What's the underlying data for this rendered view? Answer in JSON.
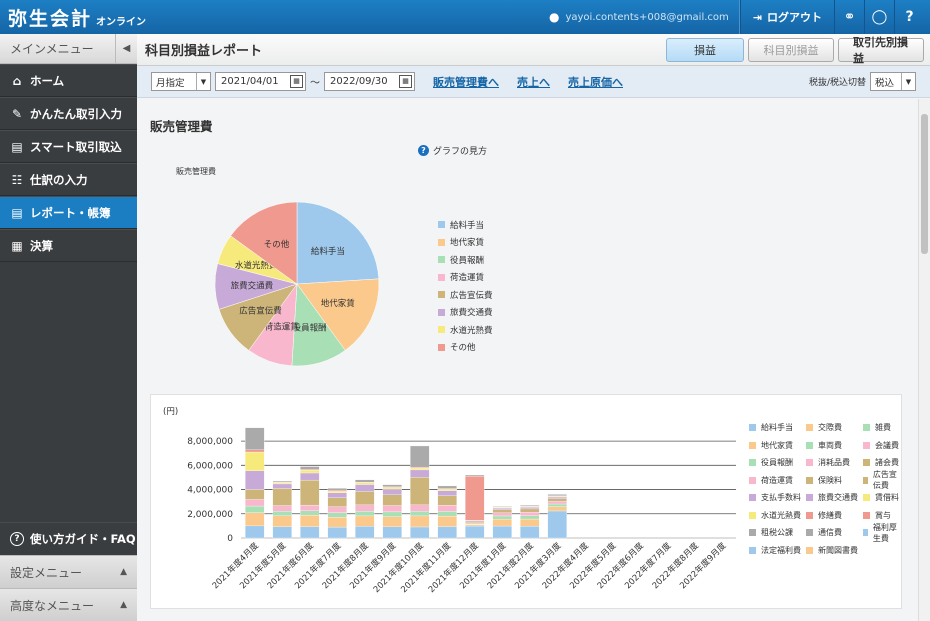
{
  "app": {
    "logo": "弥生会計",
    "logo_sub": "オンライン",
    "user_email": "yayoi.contents+008@gmail.com",
    "logout": "ログアウト"
  },
  "sidebar": {
    "header": "メインメニュー",
    "items": [
      {
        "label": "ホーム",
        "icon": "home-icon"
      },
      {
        "label": "かんたん取引入力",
        "icon": "pencil-icon"
      },
      {
        "label": "スマート取引取込",
        "icon": "import-icon"
      },
      {
        "label": "仕訳の入力",
        "icon": "journal-icon"
      },
      {
        "label": "レポート・帳簿",
        "icon": "chart-icon"
      },
      {
        "label": "決算",
        "icon": "calculator-icon"
      }
    ],
    "guide": "使い方ガイド・FAQ",
    "settings_menu": "設定メニュー",
    "advanced_menu": "高度なメニュー"
  },
  "header": {
    "title": "科目別損益レポート",
    "tabs": [
      "損益",
      "科目別損益",
      "取引先別損益"
    ]
  },
  "filter": {
    "period_mode": "月指定",
    "date_from": "2021/04/01",
    "tilde": "～",
    "date_to": "2022/09/30",
    "links": [
      "販売管理費へ",
      "売上へ",
      "売上原価へ"
    ],
    "tax_label": "税抜/税込切替",
    "tax_value": "税込"
  },
  "section": {
    "title": "販売管理費",
    "help": "グラフの見方",
    "pie_caption": "販売管理費",
    "bar_unit": "(円)"
  },
  "colors": {
    "topbar": "#1b74b8",
    "active": "#1b7ec2",
    "sidebar": "#3a3d40"
  },
  "chart_data": [
    {
      "type": "pie",
      "title": "販売管理費",
      "categories": [
        "給料手当",
        "地代家賃",
        "役員報酬",
        "荷造運賃",
        "広告宣伝費",
        "旅費交通費",
        "水道光熱費",
        "その他"
      ],
      "values": [
        24,
        16,
        11,
        9,
        10,
        9,
        6,
        15
      ],
      "colors": [
        "#9ec9ec",
        "#fbc98b",
        "#a9dfb5",
        "#f8b7cd",
        "#cdb57a",
        "#c8aad8",
        "#f7ea7c",
        "#f0998f"
      ],
      "slice_labels": [
        "給料手当",
        "地代家賃",
        "役員報酬",
        "荷造運賃",
        "広告宣伝費",
        "旅費交通費",
        "水道光熱費",
        "その他"
      ],
      "legend_position": "right"
    },
    {
      "type": "bar",
      "ylabel": "(円)",
      "ylim": [
        0,
        9000000
      ],
      "yticks": [
        "0",
        "2,000,000",
        "4,000,000",
        "6,000,000",
        "8,000,000"
      ],
      "categories": [
        "2021年度4月度",
        "2021年度5月度",
        "2021年度6月度",
        "2021年度7月度",
        "2021年度8月度",
        "2021年度9月度",
        "2021年度10月度",
        "2021年度11月度",
        "2021年度12月度",
        "2021年度1月度",
        "2021年度2月度",
        "2021年度3月度",
        "2022年度4月度",
        "2022年度5月度",
        "2022年度6月度",
        "2022年度7月度",
        "2022年度8月度",
        "2022年度9月度"
      ],
      "totals": [
        9100000,
        4700000,
        5900000,
        4100000,
        4800000,
        4400000,
        7600000,
        4300000,
        5200000,
        2600000,
        2700000,
        3600000,
        0,
        0,
        0,
        0,
        0,
        0
      ],
      "series_legend": [
        {
          "name": "給料手当",
          "color": "#9ec9ec"
        },
        {
          "name": "交際費",
          "color": "#fbc98b"
        },
        {
          "name": "雑費",
          "color": "#a9dfb5"
        },
        {
          "name": "地代家賃",
          "color": "#fbc98b"
        },
        {
          "name": "車両費",
          "color": "#a9dfb5"
        },
        {
          "name": "会議費",
          "color": "#f8b7cd"
        },
        {
          "name": "役員報酬",
          "color": "#a9dfb5"
        },
        {
          "name": "消耗品費",
          "color": "#f8b7cd"
        },
        {
          "name": "諸会費",
          "color": "#cdb57a"
        },
        {
          "name": "荷造運賃",
          "color": "#f8b7cd"
        },
        {
          "name": "保険料",
          "color": "#cdb57a"
        },
        {
          "name": "広告宣伝費",
          "color": "#cdb57a"
        },
        {
          "name": "支払手数料",
          "color": "#c8aad8"
        },
        {
          "name": "旅費交通費",
          "color": "#c8aad8"
        },
        {
          "name": "賃借料",
          "color": "#f7ea7c"
        },
        {
          "name": "水道光熱費",
          "color": "#f7ea7c"
        },
        {
          "name": "修繕費",
          "color": "#f0998f"
        },
        {
          "name": "賞与",
          "color": "#f0998f"
        },
        {
          "name": "租税公課",
          "color": "#aaaaaa"
        },
        {
          "name": "通信費",
          "color": "#aaaaaa"
        },
        {
          "name": "福利厚生費",
          "color": "#9ec9ec"
        },
        {
          "name": "法定福利費",
          "color": "#9ec9ec"
        },
        {
          "name": "新聞図書費",
          "color": "#fbc98b"
        }
      ],
      "stack_colors": [
        "#9ec9ec",
        "#fbc98b",
        "#a9dfb5",
        "#f8b7cd",
        "#cdb57a",
        "#c8aad8",
        "#f7ea7c",
        "#f0998f",
        "#aaaaaa"
      ],
      "stack_shares": [
        [
          0.11,
          0.12,
          0.06,
          0.06,
          0.09,
          0.17,
          0.17,
          0.02,
          0.2
        ],
        [
          0.2,
          0.19,
          0.08,
          0.1,
          0.3,
          0.08,
          0.02,
          0.01,
          0.02
        ],
        [
          0.16,
          0.16,
          0.06,
          0.08,
          0.35,
          0.1,
          0.04,
          0.01,
          0.04
        ],
        [
          0.22,
          0.2,
          0.09,
          0.12,
          0.18,
          0.1,
          0.03,
          0.02,
          0.04
        ],
        [
          0.2,
          0.18,
          0.08,
          0.11,
          0.23,
          0.12,
          0.03,
          0.01,
          0.04
        ],
        [
          0.21,
          0.19,
          0.09,
          0.12,
          0.2,
          0.11,
          0.03,
          0.01,
          0.04
        ],
        [
          0.12,
          0.12,
          0.05,
          0.07,
          0.3,
          0.08,
          0.02,
          0.01,
          0.23
        ],
        [
          0.22,
          0.2,
          0.09,
          0.12,
          0.18,
          0.1,
          0.03,
          0.01,
          0.05
        ],
        [
          0.19,
          0.02,
          0.01,
          0.01,
          0.02,
          0.02,
          0.01,
          0.7,
          0.02
        ],
        [
          0.38,
          0.22,
          0.1,
          0.1,
          0.1,
          0.05,
          0.02,
          0.01,
          0.02
        ],
        [
          0.36,
          0.22,
          0.1,
          0.11,
          0.1,
          0.05,
          0.02,
          0.01,
          0.03
        ],
        [
          0.62,
          0.1,
          0.06,
          0.06,
          0.06,
          0.04,
          0.02,
          0.01,
          0.03
        ],
        [
          0,
          0,
          0,
          0,
          0,
          0,
          0,
          0,
          0
        ],
        [
          0,
          0,
          0,
          0,
          0,
          0,
          0,
          0,
          0
        ],
        [
          0,
          0,
          0,
          0,
          0,
          0,
          0,
          0,
          0
        ],
        [
          0,
          0,
          0,
          0,
          0,
          0,
          0,
          0,
          0
        ],
        [
          0,
          0,
          0,
          0,
          0,
          0,
          0,
          0,
          0
        ],
        [
          0,
          0,
          0,
          0,
          0,
          0,
          0,
          0,
          0
        ]
      ],
      "grid": true,
      "legend_position": "right"
    }
  ]
}
